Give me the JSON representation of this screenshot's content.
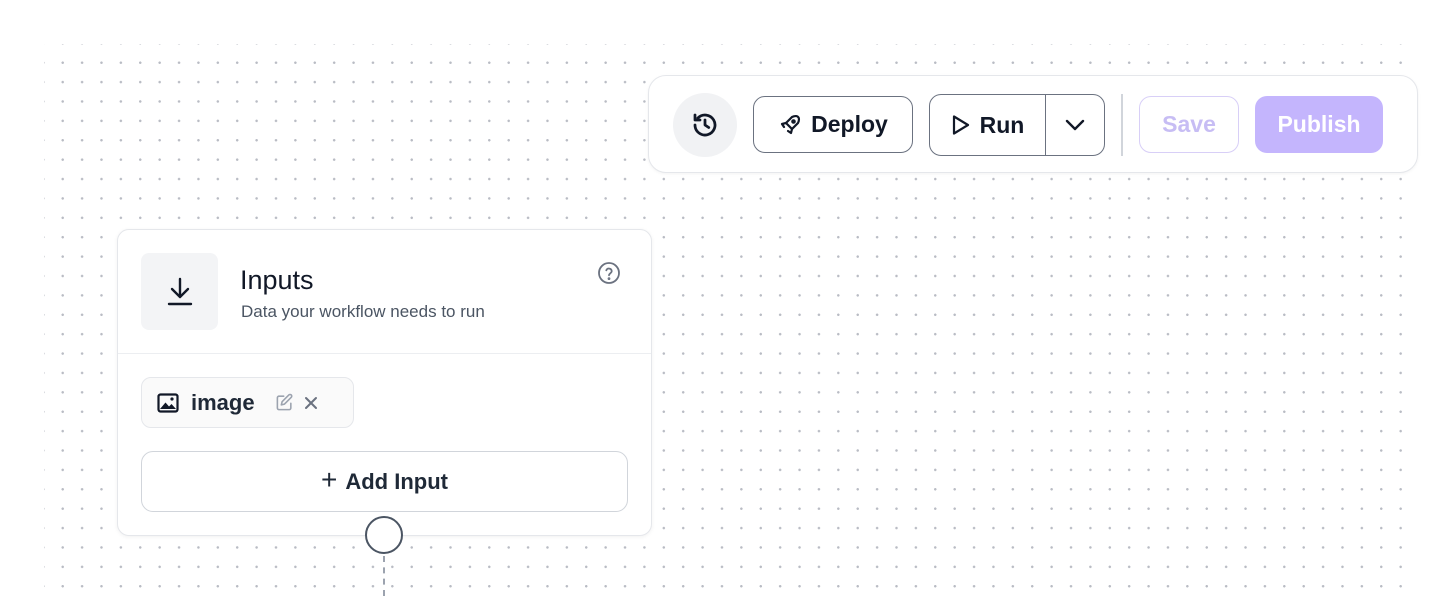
{
  "toolbar": {
    "history_icon": "history-icon",
    "deploy_label": "Deploy",
    "deploy_icon": "rocket-icon",
    "run_label": "Run",
    "run_icon": "play-icon",
    "run_options_icon": "chevron-down-icon",
    "save_label": "Save",
    "publish_label": "Publish"
  },
  "node": {
    "title": "Inputs",
    "subtitle": "Data your workflow needs to run",
    "icon": "download-icon",
    "help_icon": "help-icon",
    "inputs": [
      {
        "label": "image",
        "icon": "image-icon"
      }
    ],
    "add_input_label": "Add Input"
  },
  "colors": {
    "accent": "#c4b5fd",
    "save_text": "#c7bdf4",
    "border": "#6b7280"
  }
}
